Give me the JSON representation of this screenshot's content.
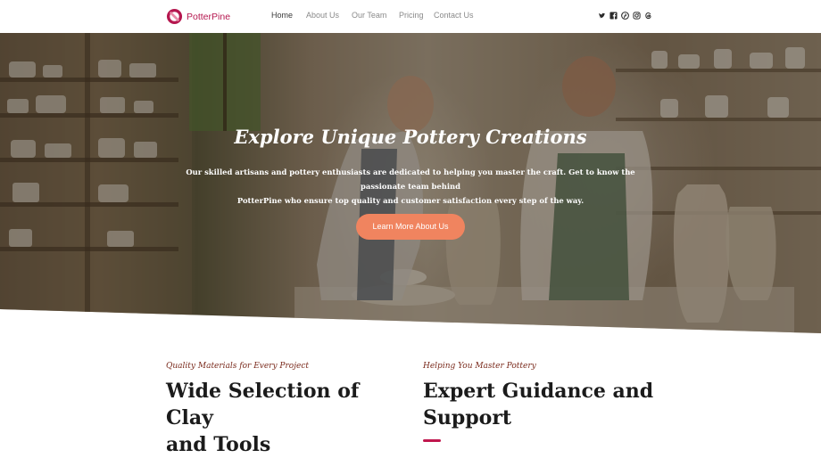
{
  "brand": {
    "name": "PotterPine",
    "logo_icon": "pottery-logo-icon",
    "color": "#b5174f"
  },
  "nav": {
    "items": [
      {
        "label": "Home",
        "active": true
      },
      {
        "label": "About Us",
        "active": false
      },
      {
        "label": "Our Team",
        "active": false
      },
      {
        "label": "Pricing",
        "active": false
      },
      {
        "label": "Contact Us",
        "active": false
      }
    ]
  },
  "socials": [
    "twitter-icon",
    "facebook-icon",
    "pinterest-icon",
    "instagram-icon",
    "threads-icon"
  ],
  "hero": {
    "title": "Explore Unique Pottery Creations",
    "subtitle_line1": "Our skilled artisans and pottery enthusiasts are dedicated to helping you master the craft. Get to know the passionate team behind",
    "subtitle_line2": "PotterPine who ensure top quality and customer satisfaction every step of the way.",
    "button_label": "Learn More About Us",
    "button_color": "#f0845f"
  },
  "features": [
    {
      "kicker": "Quality Materials for Every Project",
      "heading_line1": "Wide Selection of Clay",
      "heading_line2": "and Tools"
    },
    {
      "kicker": "Helping You Master Pottery",
      "heading_line1": "Expert Guidance and",
      "heading_line2": "Support"
    }
  ],
  "accent_color": "#c0174e"
}
